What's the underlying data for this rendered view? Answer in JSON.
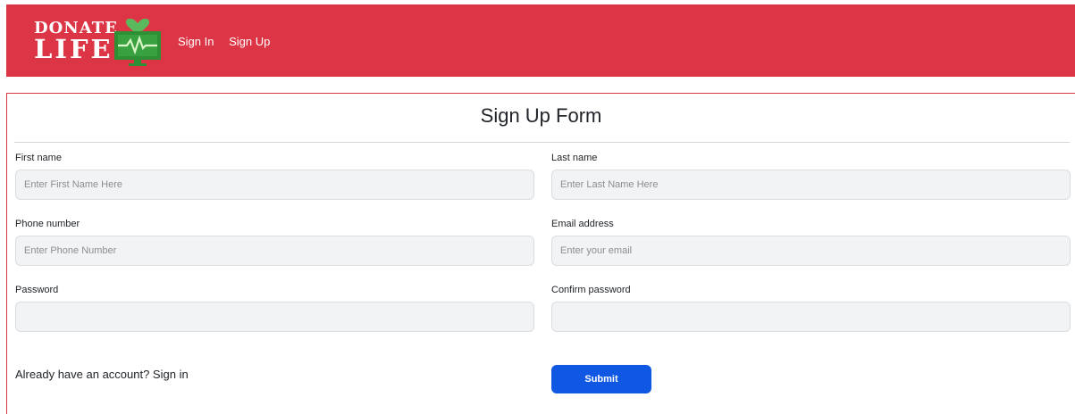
{
  "navbar": {
    "logo": {
      "line1": "DONATE",
      "line2": "LIFE",
      "icon": "heart-monitor-icon"
    },
    "links": [
      {
        "label": "Sign In"
      },
      {
        "label": "Sign Up"
      }
    ],
    "background_color": "#dc3545"
  },
  "form": {
    "title": "Sign Up Form",
    "fields": {
      "first_name": {
        "label": "First name",
        "placeholder": "Enter First Name Here",
        "value": ""
      },
      "last_name": {
        "label": "Last name",
        "placeholder": "Enter Last Name Here",
        "value": ""
      },
      "phone": {
        "label": "Phone number",
        "placeholder": "Enter Phone Number",
        "value": ""
      },
      "email": {
        "label": "Email address",
        "placeholder": "Enter your email",
        "value": ""
      },
      "password": {
        "label": "Password",
        "placeholder": "",
        "value": ""
      },
      "confirm_password": {
        "label": "Confirm password",
        "placeholder": "",
        "value": ""
      }
    },
    "signin_prompt": "Already have an account? Sign in",
    "submit_label": "Submit",
    "accent_color": "#1058e3"
  }
}
